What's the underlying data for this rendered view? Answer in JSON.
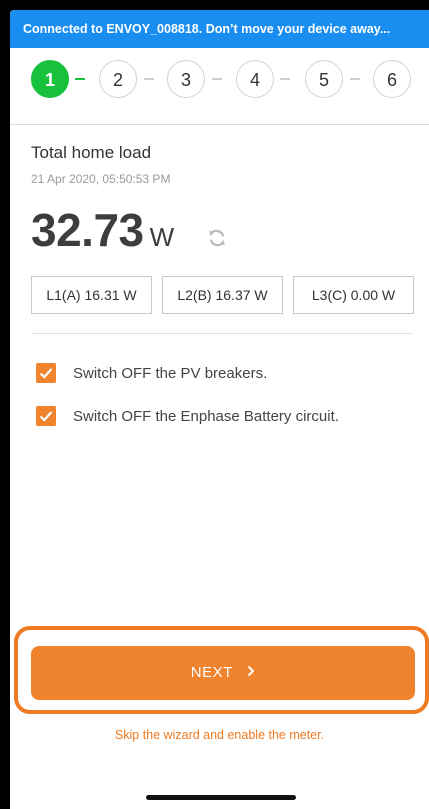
{
  "banner": {
    "text": "Connected to ENVOY_008818. Don’t move your device away..."
  },
  "stepper": {
    "steps": [
      "1",
      "2",
      "3",
      "4",
      "5",
      "6"
    ],
    "active_step": 1
  },
  "load": {
    "title": "Total home load",
    "timestamp": "21 Apr 2020, 05:50:53 PM",
    "value": "32.73",
    "unit": "W"
  },
  "phases": [
    "L1(A) 16.31 W",
    "L2(B) 16.37 W",
    "L3(C) 0.00 W"
  ],
  "checklist": [
    {
      "label": "Switch OFF the PV breakers.",
      "checked": true
    },
    {
      "label": "Switch OFF the Enphase Battery circuit.",
      "checked": true
    }
  ],
  "actions": {
    "next_label": "NEXT",
    "skip_label": "Skip the wizard and enable the meter."
  },
  "colors": {
    "banner": "#1a8ef0",
    "active_step": "#17c13c",
    "accent": "#f0832e"
  }
}
